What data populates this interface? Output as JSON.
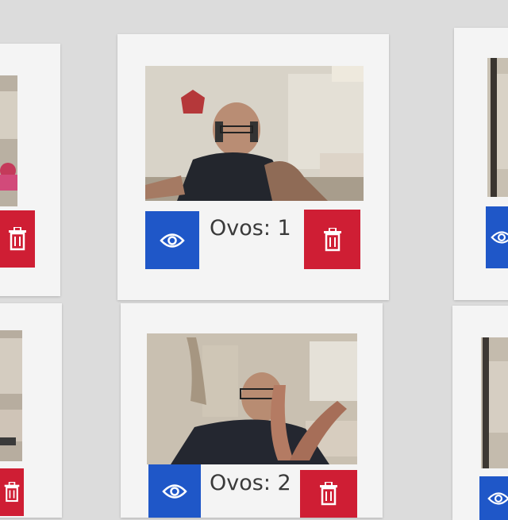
{
  "colors": {
    "background": "#dcdcdc",
    "card": "#f4f4f4",
    "view_button": "#1f57c8",
    "delete_button": "#cf1e34",
    "caption_text": "#3a3a3a"
  },
  "cards": [
    {
      "caption": "Ovos: 1",
      "view_icon": "eye-icon",
      "delete_icon": "trash-icon"
    },
    {
      "caption": "Ovos: 2",
      "view_icon": "eye-icon",
      "delete_icon": "trash-icon"
    }
  ]
}
